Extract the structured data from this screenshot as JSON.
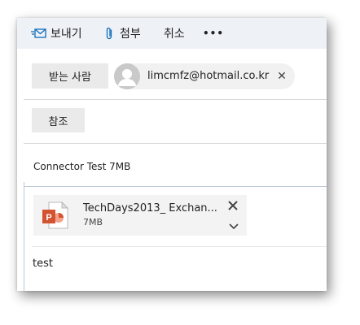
{
  "toolbar": {
    "send_label": "보내기",
    "attach_label": "첨부",
    "cancel_label": "취소",
    "more_label": "•••"
  },
  "recipients": {
    "to_button_label": "받는 사람",
    "to_address": "limcmfz@hotmail.co.kr",
    "remove_glyph": "✕",
    "cc_button_label": "참조"
  },
  "subject": "Connector Test 7MB",
  "attachment": {
    "name": "TechDays2013_ Exchan...",
    "size": "7MB",
    "file_type_icon": "powerpoint-file-icon"
  },
  "body": "test",
  "colors": {
    "toolbar_bg": "#eef1f6",
    "accent": "#0f6cbd",
    "powerpoint": "#d35230"
  }
}
